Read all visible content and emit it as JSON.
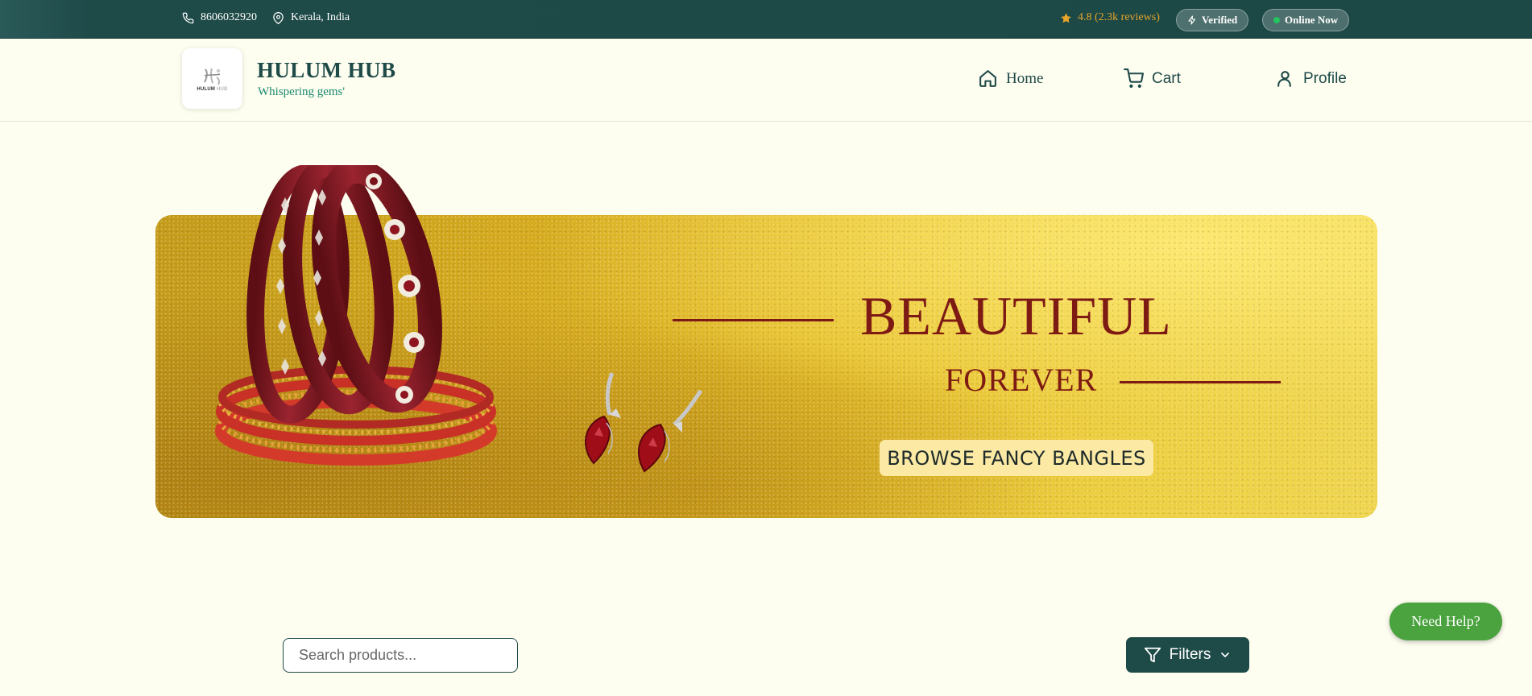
{
  "topbar": {
    "phone": "8606032920",
    "location": "Kerala, India",
    "rating": "4.8 (2.3k reviews)",
    "verified_label": "Verified",
    "online_label": "Online Now"
  },
  "header": {
    "logo_text_main": "HULUM",
    "logo_text_sub": "HUB",
    "brand_title": "HULUM HUB",
    "brand_tagline": "Whispering gems'",
    "nav": [
      {
        "label": "Home",
        "icon": "home-icon"
      },
      {
        "label": "Cart",
        "icon": "cart-icon"
      },
      {
        "label": "Profile",
        "icon": "user-icon"
      }
    ]
  },
  "banner": {
    "headline": "BEAUTIFUL",
    "subheadline": "FOREVER",
    "cta_label": "BROWSE FANCY BANGLES"
  },
  "controls": {
    "search_placeholder": "Search products...",
    "filters_label": "Filters",
    "help_label": "Need Help?"
  },
  "colors": {
    "brand_dark": "#1e4a48",
    "accent_green": "#1b8a6f",
    "star": "#e7a52a",
    "banner_text": "#7d1a14",
    "help_button": "#4aa33e"
  }
}
